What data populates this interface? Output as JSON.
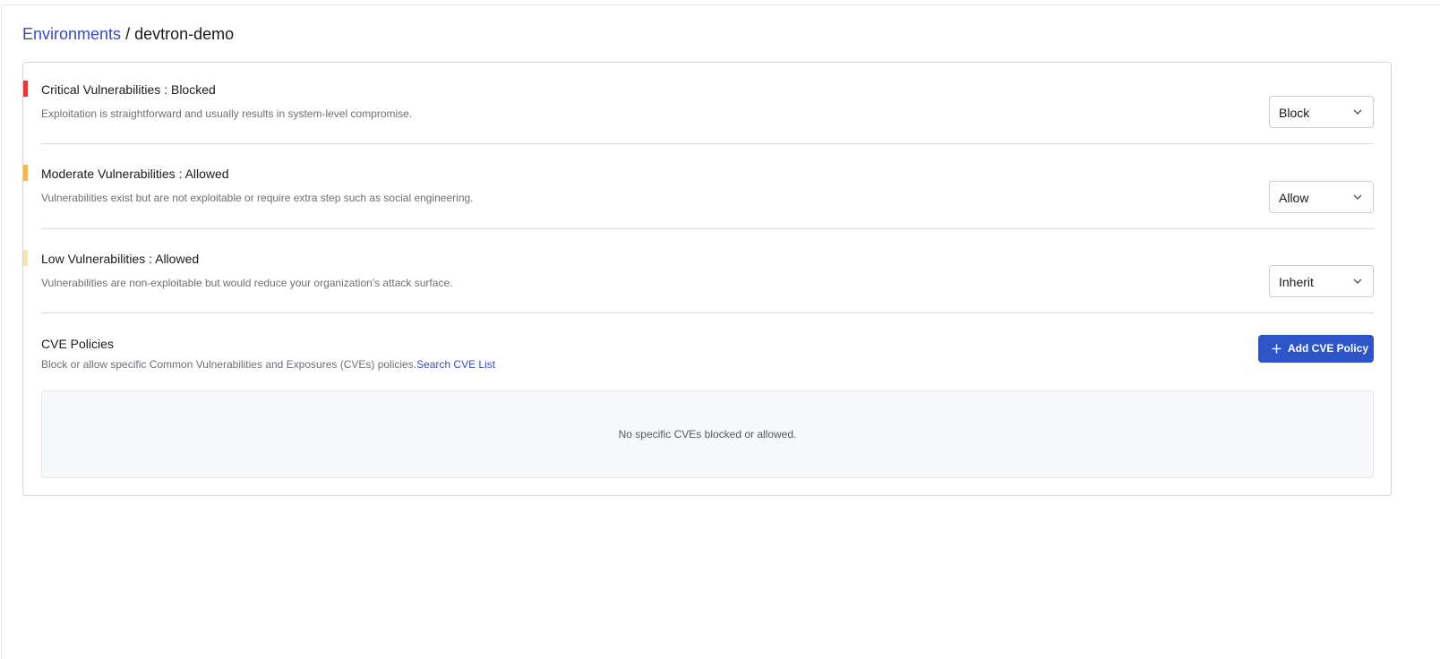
{
  "breadcrumb": {
    "parent": "Environments",
    "separator": " / ",
    "current": "devtron-demo"
  },
  "vulnerabilities": [
    {
      "title": "Critical Vulnerabilities : Blocked",
      "description": "Exploitation is straightforward and usually results in system-level compromise.",
      "action": "Block",
      "color": "#e53935"
    },
    {
      "title": "Moderate Vulnerabilities : Allowed",
      "description": "Vulnerabilities exist but are not exploitable or require extra step such as social engineering.",
      "action": "Allow",
      "color": "#f5b54a"
    },
    {
      "title": "Low Vulnerabilities : Allowed",
      "description": "Vulnerabilities are non-exploitable but would reduce your organization's attack surface.",
      "action": "Inherit",
      "color": "#fbe3b8"
    }
  ],
  "cve": {
    "title": "CVE Policies",
    "description": "Block or allow specific Common Vulnerabilities and Exposures (CVEs) policies.",
    "search_link": "Search CVE List",
    "add_button": "Add CVE Policy",
    "empty_message": "No specific CVEs blocked or allowed.",
    "button_color": "#2d55c9"
  },
  "icons": {
    "dropdown": "chevron-down-icon",
    "add": "plus-icon"
  }
}
